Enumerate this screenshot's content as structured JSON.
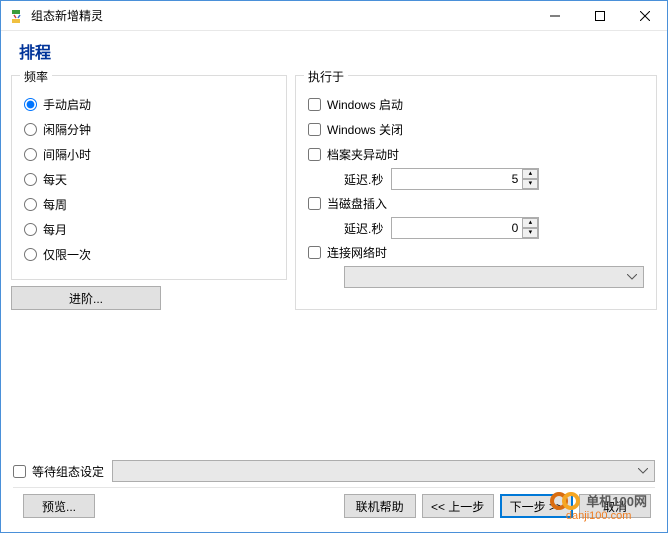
{
  "window": {
    "title": "组态新增精灵"
  },
  "heading": "排程",
  "frequency": {
    "group_label": "频率",
    "items": [
      {
        "label": "手动启动",
        "checked": true
      },
      {
        "label": "闲隔分钟",
        "checked": false
      },
      {
        "label": "间隔小时",
        "checked": false
      },
      {
        "label": "每天",
        "checked": false
      },
      {
        "label": "每周",
        "checked": false
      },
      {
        "label": "每月",
        "checked": false
      },
      {
        "label": "仅限一次",
        "checked": false
      }
    ],
    "advanced_label": "进阶..."
  },
  "execute_on": {
    "group_label": "执行于",
    "windows_start": "Windows 启动",
    "windows_shutdown": "Windows 关闭",
    "folder_change": "档案夹异动时",
    "delay_label": "延迟.秒",
    "delay_folder_value": "5",
    "disk_insert": "当磁盘插入",
    "delay_disk_value": "0",
    "network_connect": "连接网络时"
  },
  "wait_config": {
    "label": "等待组态设定"
  },
  "footer": {
    "preview": "预览...",
    "online_help": "联机帮助",
    "prev": "<< 上一步",
    "next": "下一步 >>",
    "cancel": "取消"
  },
  "watermark": {
    "line1": "单机100网",
    "line2": "danji100.com"
  }
}
